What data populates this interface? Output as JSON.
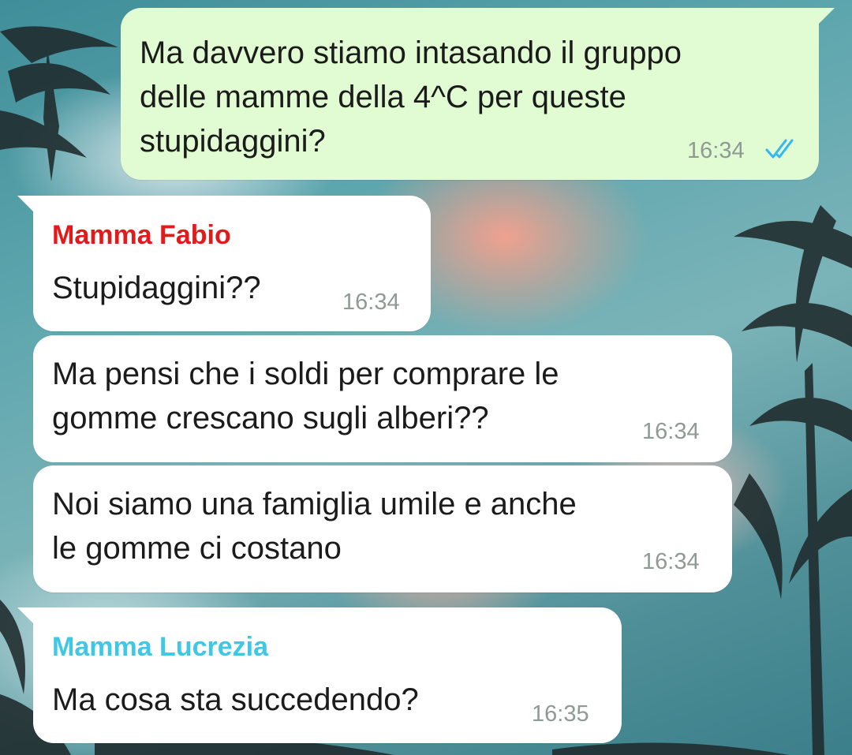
{
  "theme": {
    "outgoing_bubble": "#e1fbd3",
    "incoming_bubble": "#ffffff",
    "read_ticks": "#34b7f1"
  },
  "messages": [
    {
      "direction": "outgoing",
      "lines": [
        "Ma davvero stiamo intasando il gruppo",
        "delle mamme della 4^C per queste",
        "stupidaggini?"
      ],
      "time": "16:34",
      "status_icon": "double-check-read-icon"
    },
    {
      "direction": "incoming",
      "sender": "Mamma Fabio",
      "sender_color": "#e01b1b",
      "lines": [
        "Stupidaggini??"
      ],
      "time": "16:34"
    },
    {
      "direction": "incoming",
      "lines": [
        "Ma pensi che i soldi per comprare le",
        "gomme crescano sugli alberi??"
      ],
      "time": "16:34"
    },
    {
      "direction": "incoming",
      "lines": [
        "Noi siamo una famiglia umile e anche",
        "le gomme ci costano"
      ],
      "time": "16:34"
    },
    {
      "direction": "incoming",
      "sender": "Mamma Lucrezia",
      "sender_color": "#3fc7e6",
      "lines": [
        "Ma cosa sta succedendo?"
      ],
      "time": "16:35"
    }
  ]
}
